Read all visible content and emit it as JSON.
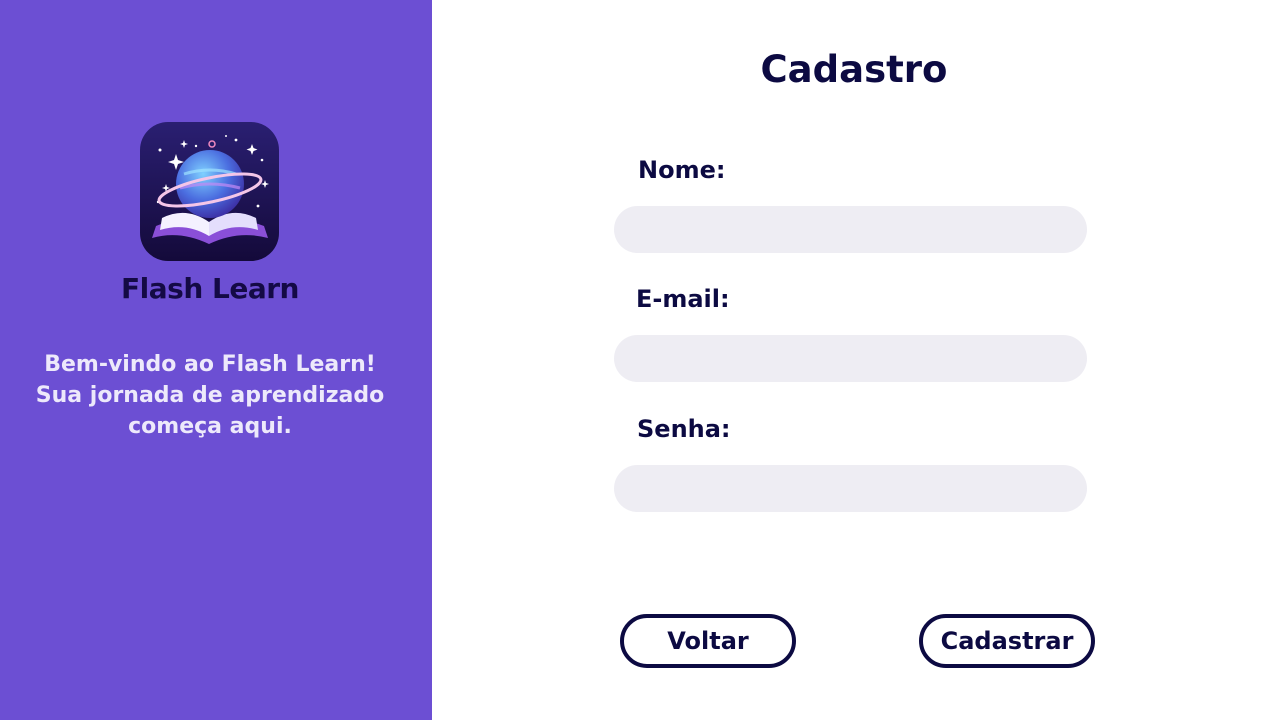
{
  "brand": {
    "name": "Flash Learn",
    "welcome_lines": [
      "Bem-vindo ao Flash Learn!",
      "Sua jornada de aprendizado",
      "começa aqui."
    ]
  },
  "form": {
    "title": "Cadastro",
    "fields": [
      {
        "label": "Nome:",
        "value": "",
        "placeholder": ""
      },
      {
        "label": "E-mail:",
        "value": "",
        "placeholder": ""
      },
      {
        "label": "Senha:",
        "value": "",
        "placeholder": ""
      }
    ],
    "back_label": "Voltar",
    "submit_label": "Cadastrar"
  },
  "colors": {
    "panel": "#6c4fd3",
    "text_dark": "#0c0a42",
    "input_bg": "#eeedf3"
  },
  "icons": {
    "logo": "planet-book-logo-icon"
  }
}
